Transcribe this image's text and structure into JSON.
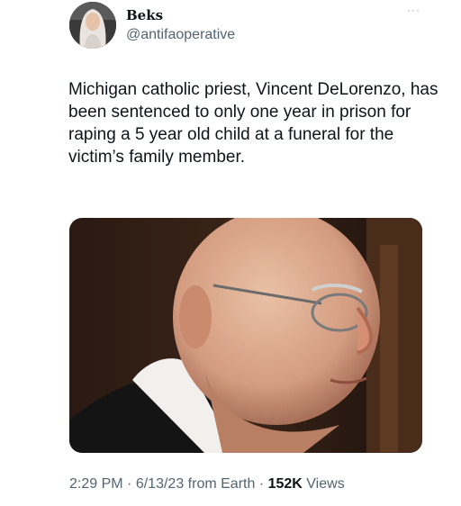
{
  "tweet": {
    "author": {
      "display_name": "Beks",
      "handle": "@antifaoperative"
    },
    "more_label": "···",
    "text": "Michigan catholic priest, Vincent DeLorenzo, has been sentenced to only one year in prison for raping a 5 year old child at a funeral for the victim’s family member.",
    "meta": {
      "time": "2:29 PM",
      "separator": "·",
      "date": "6/13/23",
      "source": "from Earth",
      "views_count": "152K",
      "views_label": "Views"
    }
  }
}
